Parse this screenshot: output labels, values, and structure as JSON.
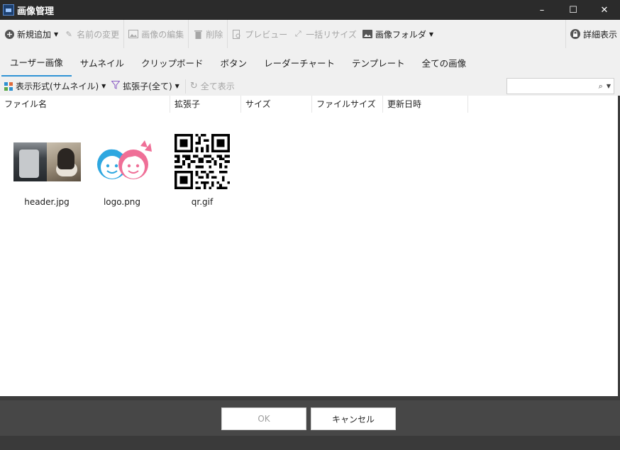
{
  "window": {
    "title": "画像管理",
    "minimize": "–",
    "maximize": "☐",
    "close": "✕"
  },
  "toolbar": {
    "new_add": "新規追加",
    "rename": "名前の変更",
    "edit_image": "画像の編集",
    "delete": "削除",
    "preview": "プレビュー",
    "batch_resize": "一括リサイズ",
    "image_folder": "画像フォルダ",
    "details": "詳細表示"
  },
  "tabs": [
    {
      "label": "ユーザー画像",
      "active": true
    },
    {
      "label": "サムネイル"
    },
    {
      "label": "クリップボード"
    },
    {
      "label": "ボタン"
    },
    {
      "label": "レーダーチャート"
    },
    {
      "label": "テンプレート"
    },
    {
      "label": "全ての画像"
    }
  ],
  "viewbar": {
    "display_mode": "表示形式(サムネイル)",
    "extension_filter": "拡張子(全て)",
    "show_all": "全て表示",
    "search_placeholder": ""
  },
  "columns": [
    "ファイル名",
    "拡張子",
    "サイズ",
    "ファイルサイズ",
    "更新日時"
  ],
  "files": [
    {
      "name": "header.jpg",
      "thumb": "photo-thumbnail"
    },
    {
      "name": "logo.png",
      "thumb": "kids-logo-thumbnail"
    },
    {
      "name": "qr.gif",
      "thumb": "qr-code-thumbnail"
    }
  ],
  "footer": {
    "ok": "OK",
    "cancel": "キャンセル"
  },
  "colors": {
    "tab_active": "#2f93d5",
    "logo_blue": "#2ea7e0",
    "logo_pink": "#ef6f97"
  }
}
